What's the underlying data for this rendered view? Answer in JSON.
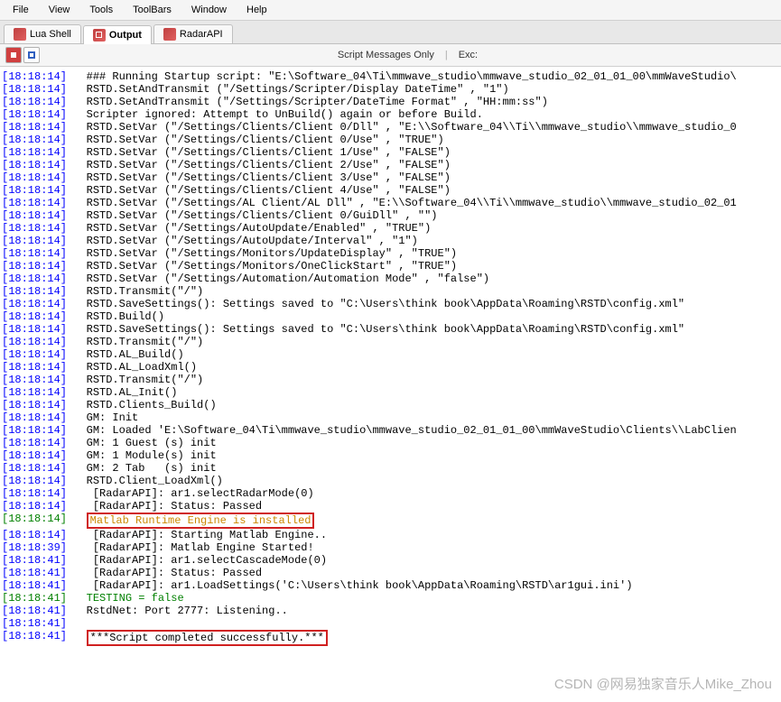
{
  "menu": {
    "items": [
      "File",
      "View",
      "Tools",
      "ToolBars",
      "Window",
      "Help"
    ]
  },
  "tabs": [
    {
      "label": "Lua Shell",
      "active": false
    },
    {
      "label": "Output",
      "active": true
    },
    {
      "label": "RadarAPI",
      "active": false
    }
  ],
  "toolbar": {
    "center_label": "Script Messages Only",
    "exc_label": "Exc:"
  },
  "log": [
    {
      "ts": "[18:18:14]",
      "c": "n",
      "m": "### Running Startup script: \"E:\\Software_04\\Ti\\mmwave_studio\\mmwave_studio_02_01_01_00\\mmWaveStudio\\"
    },
    {
      "ts": "[18:18:14]",
      "c": "n",
      "m": "RSTD.SetAndTransmit (\"/Settings/Scripter/Display DateTime\" , \"1\")"
    },
    {
      "ts": "[18:18:14]",
      "c": "n",
      "m": "RSTD.SetAndTransmit (\"/Settings/Scripter/DateTime Format\" , \"HH:mm:ss\")"
    },
    {
      "ts": "[18:18:14]",
      "c": "n",
      "m": "Scripter ignored: Attempt to UnBuild() again or before Build."
    },
    {
      "ts": "[18:18:14]",
      "c": "n",
      "m": "RSTD.SetVar (\"/Settings/Clients/Client 0/Dll\" , \"E:\\\\Software_04\\\\Ti\\\\mmwave_studio\\\\mmwave_studio_0"
    },
    {
      "ts": "[18:18:14]",
      "c": "n",
      "m": "RSTD.SetVar (\"/Settings/Clients/Client 0/Use\" , \"TRUE\")"
    },
    {
      "ts": "[18:18:14]",
      "c": "n",
      "m": "RSTD.SetVar (\"/Settings/Clients/Client 1/Use\" , \"FALSE\")"
    },
    {
      "ts": "[18:18:14]",
      "c": "n",
      "m": "RSTD.SetVar (\"/Settings/Clients/Client 2/Use\" , \"FALSE\")"
    },
    {
      "ts": "[18:18:14]",
      "c": "n",
      "m": "RSTD.SetVar (\"/Settings/Clients/Client 3/Use\" , \"FALSE\")"
    },
    {
      "ts": "[18:18:14]",
      "c": "n",
      "m": "RSTD.SetVar (\"/Settings/Clients/Client 4/Use\" , \"FALSE\")"
    },
    {
      "ts": "[18:18:14]",
      "c": "n",
      "m": "RSTD.SetVar (\"/Settings/AL Client/AL Dll\" , \"E:\\\\Software_04\\\\Ti\\\\mmwave_studio\\\\mmwave_studio_02_01"
    },
    {
      "ts": "[18:18:14]",
      "c": "n",
      "m": "RSTD.SetVar (\"/Settings/Clients/Client 0/GuiDll\" , \"\")"
    },
    {
      "ts": "[18:18:14]",
      "c": "n",
      "m": "RSTD.SetVar (\"/Settings/AutoUpdate/Enabled\" , \"TRUE\")"
    },
    {
      "ts": "[18:18:14]",
      "c": "n",
      "m": "RSTD.SetVar (\"/Settings/AutoUpdate/Interval\" , \"1\")"
    },
    {
      "ts": "[18:18:14]",
      "c": "n",
      "m": "RSTD.SetVar (\"/Settings/Monitors/UpdateDisplay\" , \"TRUE\")"
    },
    {
      "ts": "[18:18:14]",
      "c": "n",
      "m": "RSTD.SetVar (\"/Settings/Monitors/OneClickStart\" , \"TRUE\")"
    },
    {
      "ts": "[18:18:14]",
      "c": "n",
      "m": "RSTD.SetVar (\"/Settings/Automation/Automation Mode\" , \"false\")"
    },
    {
      "ts": "[18:18:14]",
      "c": "n",
      "m": "RSTD.Transmit(\"/\")"
    },
    {
      "ts": "[18:18:14]",
      "c": "n",
      "m": "RSTD.SaveSettings(): Settings saved to \"C:\\Users\\think book\\AppData\\Roaming\\RSTD\\config.xml\""
    },
    {
      "ts": "[18:18:14]",
      "c": "n",
      "m": "RSTD.Build()"
    },
    {
      "ts": "[18:18:14]",
      "c": "n",
      "m": "RSTD.SaveSettings(): Settings saved to \"C:\\Users\\think book\\AppData\\Roaming\\RSTD\\config.xml\""
    },
    {
      "ts": "[18:18:14]",
      "c": "n",
      "m": "RSTD.Transmit(\"/\")"
    },
    {
      "ts": "[18:18:14]",
      "c": "n",
      "m": "RSTD.AL_Build()"
    },
    {
      "ts": "[18:18:14]",
      "c": "n",
      "m": "RSTD.AL_LoadXml()"
    },
    {
      "ts": "[18:18:14]",
      "c": "n",
      "m": "RSTD.Transmit(\"/\")"
    },
    {
      "ts": "[18:18:14]",
      "c": "n",
      "m": "RSTD.AL_Init()"
    },
    {
      "ts": "[18:18:14]",
      "c": "n",
      "m": "RSTD.Clients_Build()"
    },
    {
      "ts": "[18:18:14]",
      "c": "n",
      "m": "GM: Init"
    },
    {
      "ts": "[18:18:14]",
      "c": "n",
      "m": "GM: Loaded 'E:\\Software_04\\Ti\\mmwave_studio\\mmwave_studio_02_01_01_00\\mmWaveStudio\\Clients\\\\LabClien"
    },
    {
      "ts": "[18:18:14]",
      "c": "n",
      "m": "GM: 1 Guest (s) init"
    },
    {
      "ts": "[18:18:14]",
      "c": "n",
      "m": "GM: 1 Module(s) init"
    },
    {
      "ts": "[18:18:14]",
      "c": "n",
      "m": "GM: 2 Tab   (s) init"
    },
    {
      "ts": "[18:18:14]",
      "c": "n",
      "m": "RSTD.Client_LoadXml()"
    },
    {
      "ts": "[18:18:14]",
      "c": "n",
      "m": " [RadarAPI]: ar1.selectRadarMode(0)"
    },
    {
      "ts": "[18:18:14]",
      "c": "n",
      "m": " [RadarAPI]: Status: Passed"
    },
    {
      "ts": "[18:18:14]",
      "c": "o",
      "m": "Matlab Runtime Engine is installed",
      "hl": true,
      "tsc": "g"
    },
    {
      "ts": "[18:18:14]",
      "c": "n",
      "m": " [RadarAPI]: Starting Matlab Engine.."
    },
    {
      "ts": "[18:18:39]",
      "c": "n",
      "m": " [RadarAPI]: Matlab Engine Started!"
    },
    {
      "ts": "[18:18:41]",
      "c": "n",
      "m": " [RadarAPI]: ar1.selectCascadeMode(0)"
    },
    {
      "ts": "[18:18:41]",
      "c": "n",
      "m": " [RadarAPI]: Status: Passed"
    },
    {
      "ts": "[18:18:41]",
      "c": "n",
      "m": " [RadarAPI]: ar1.LoadSettings('C:\\Users\\think book\\AppData\\Roaming\\RSTD\\ar1gui.ini')"
    },
    {
      "ts": "[18:18:41]",
      "c": "g",
      "m": "TESTING = false",
      "tsc": "g"
    },
    {
      "ts": "[18:18:41]",
      "c": "n",
      "m": "RstdNet: Port 2777: Listening.."
    },
    {
      "ts": "[18:18:41]",
      "c": "n",
      "m": ""
    },
    {
      "ts": "[18:18:41]",
      "c": "n",
      "m": "***Script completed successfully.***",
      "hl": true
    }
  ],
  "watermark": "CSDN @网易独家音乐人Mike_Zhou"
}
